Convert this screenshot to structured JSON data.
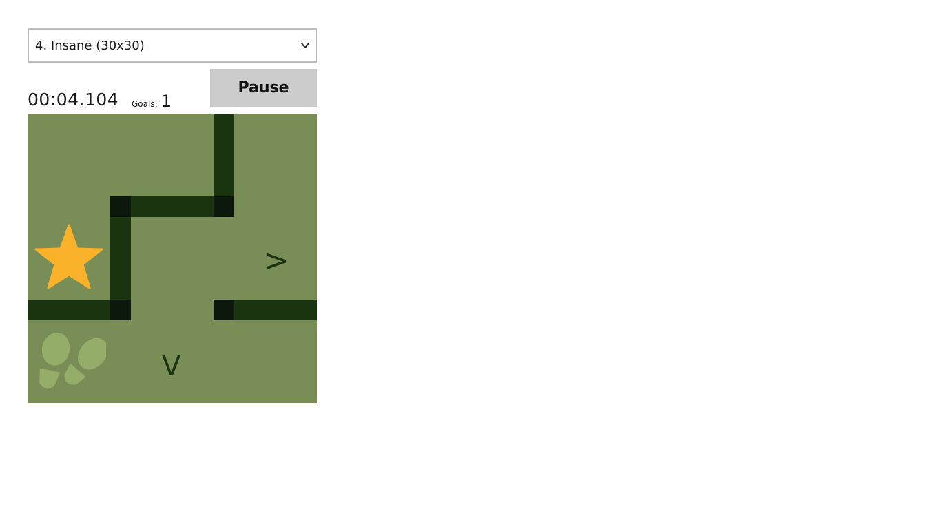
{
  "level_select": {
    "value": "4. Insane (30x30)",
    "icon": "chevron-down-icon"
  },
  "status": {
    "timer": "00:04.104",
    "goals_label": "Goals:",
    "goals_value": "1"
  },
  "pause_button": {
    "label": "Pause"
  },
  "board": {
    "colors": {
      "floor": "#798d57",
      "wall": "#1b3410",
      "joint": "#0c180b",
      "star": "#fbb22b",
      "footprints": "#94ae6a"
    },
    "goal_icon": "star-icon",
    "player_icon": "footprints-icon",
    "arrow_right": ">",
    "arrow_down": "V"
  }
}
